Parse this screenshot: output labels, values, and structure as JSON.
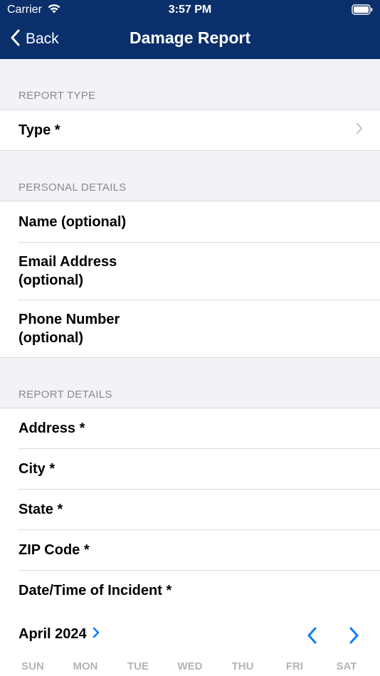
{
  "status_bar": {
    "carrier": "Carrier",
    "time": "3:57 PM"
  },
  "nav": {
    "back_label": "Back",
    "title": "Damage Report"
  },
  "sections": {
    "report_type": {
      "header": "REPORT TYPE",
      "rows": [
        "Type *"
      ]
    },
    "personal_details": {
      "header": "PERSONAL DETAILS",
      "rows": [
        "Name (optional)",
        "Email Address (optional)",
        "Phone Number (optional)"
      ]
    },
    "report_details": {
      "header": "REPORT DETAILS",
      "rows": [
        "Address *",
        "City *",
        "State *",
        "ZIP Code *",
        "Date/Time of Incident *"
      ]
    }
  },
  "calendar": {
    "month_label": "April 2024",
    "weekdays": [
      "SUN",
      "MON",
      "TUE",
      "WED",
      "THU",
      "FRI",
      "SAT"
    ]
  },
  "colors": {
    "nav_bg": "#0a2f6b",
    "accent": "#0a7aff",
    "background": "#f2f2f7"
  }
}
